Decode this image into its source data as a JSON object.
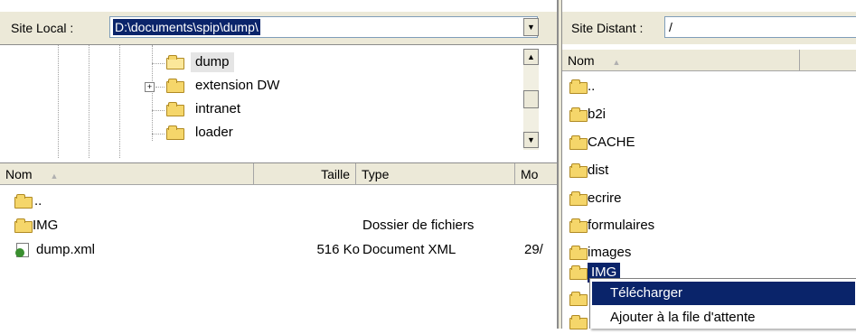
{
  "local": {
    "label": "Site Local :",
    "path": "D:\\documents\\spip\\dump\\",
    "tree": [
      {
        "name": "dump",
        "selected": true
      },
      {
        "name": "extension DW",
        "expandable": true
      },
      {
        "name": "intranet"
      },
      {
        "name": "loader"
      }
    ],
    "columns": {
      "name": "Nom",
      "sort_icon": "▲",
      "size": "Taille",
      "type": "Type",
      "modified": "Mo"
    },
    "files": [
      {
        "name": "..",
        "size": "",
        "type": "",
        "modified": ""
      },
      {
        "name": "IMG",
        "size": "",
        "type": "Dossier de fichiers",
        "modified": ""
      },
      {
        "name": "dump.xml",
        "size": "516 Ko",
        "type": "Document XML",
        "modified": "29/"
      }
    ]
  },
  "remote": {
    "label": "Site Distant :",
    "path": "/",
    "columns": {
      "name": "Nom",
      "sort_icon": "▲"
    },
    "items": [
      "..",
      "b2i",
      "CACHE",
      "dist",
      "ecrire",
      "formulaires",
      "images",
      "IMG"
    ]
  },
  "context_menu": {
    "items": [
      "Télécharger",
      "Ajouter à la file d'attente"
    ],
    "highlight_color": "#0a246a"
  },
  "icons": {
    "folder": "folder-icon",
    "xml_file": "xml-file-icon",
    "dropdown": "chevron-down-icon",
    "expand": "plus-box-icon"
  }
}
